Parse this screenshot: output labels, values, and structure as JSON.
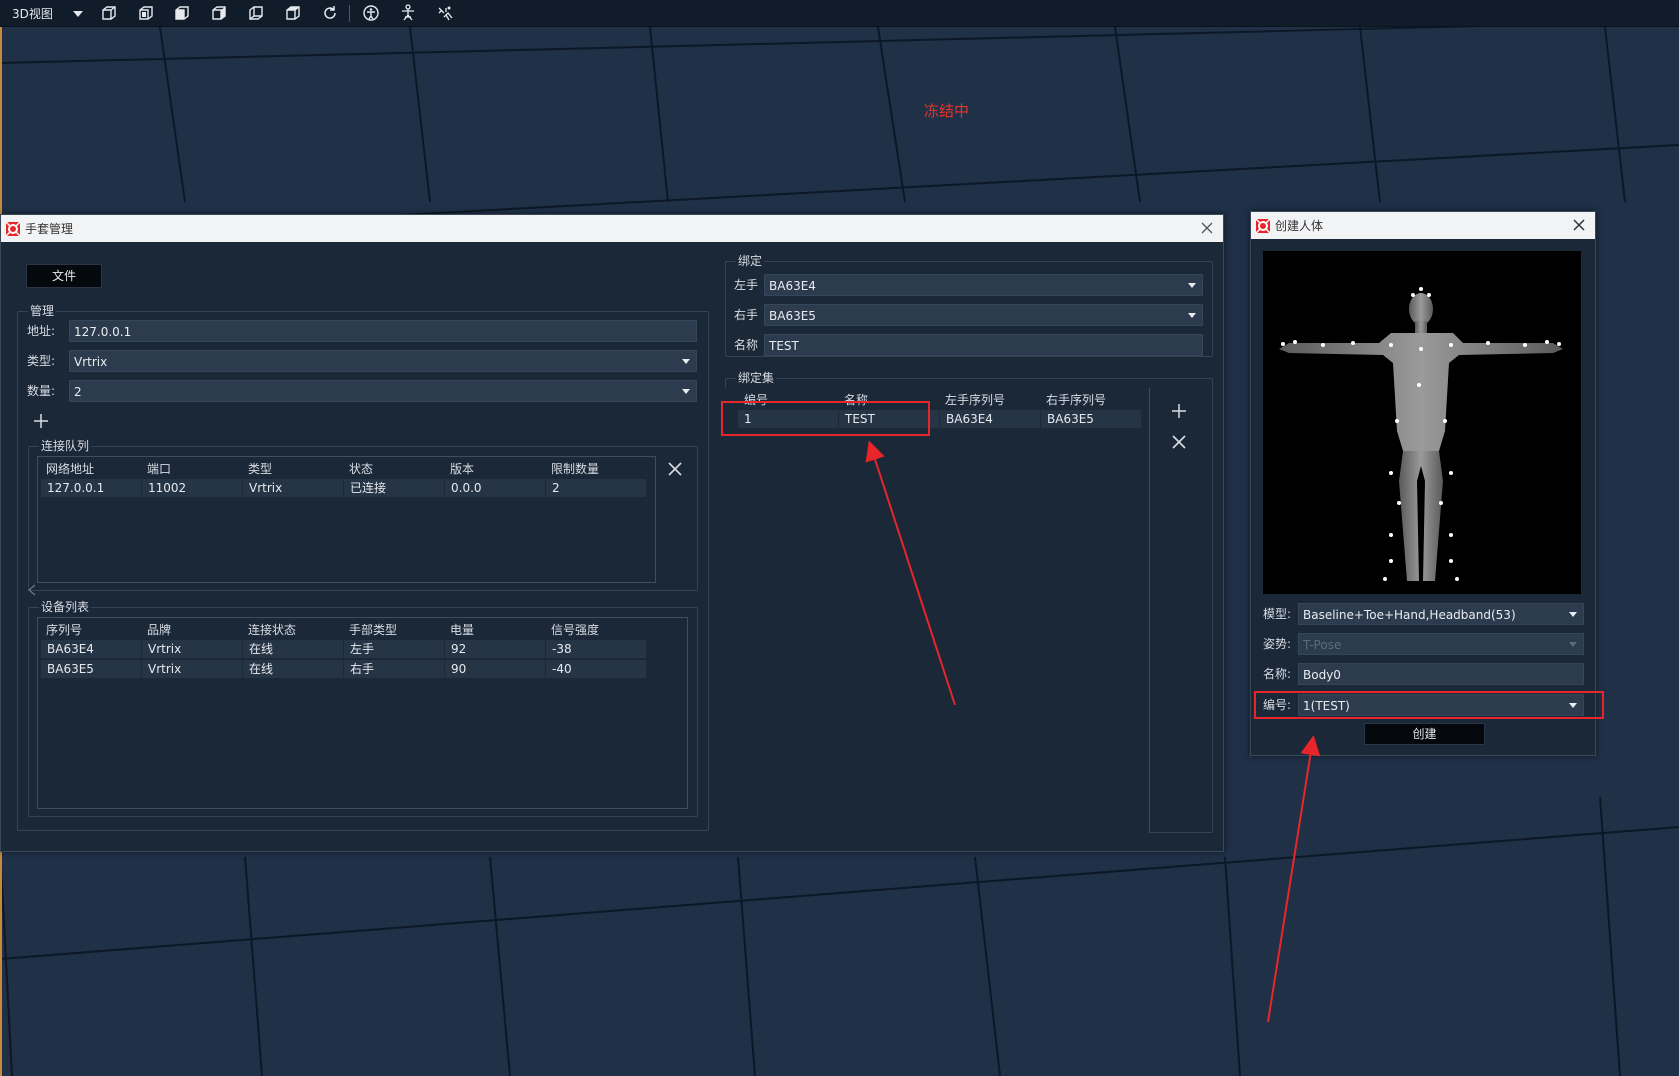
{
  "toolbar": {
    "view_label": "3D视图",
    "icons": [
      "front-view-icon",
      "perspective-view-icon",
      "left-view-icon",
      "right-view-icon",
      "back-view-icon",
      "top-view-icon",
      "refresh-icon",
      "person-icon",
      "skeleton-icon",
      "tracker-icon"
    ]
  },
  "viewport": {
    "status_text": "冻结中"
  },
  "glove_manager": {
    "title": "手套管理",
    "file_button": "文件",
    "manage": {
      "title": "管理",
      "address_label": "地址:",
      "address_value": "127.0.0.1",
      "type_label": "类型:",
      "type_value": "Vrtrix",
      "count_label": "数量:",
      "count_value": "2"
    },
    "connection_queue": {
      "title": "连接队列",
      "columns": [
        "网络地址",
        "端口",
        "类型",
        "状态",
        "版本",
        "限制数量"
      ],
      "rows": [
        [
          "127.0.0.1",
          "11002",
          "Vrtrix",
          "已连接",
          "0.0.0",
          "2"
        ]
      ]
    },
    "device_list": {
      "title": "设备列表",
      "columns": [
        "序列号",
        "品牌",
        "连接状态",
        "手部类型",
        "电量",
        "信号强度"
      ],
      "rows": [
        [
          "BA63E4",
          "Vrtrix",
          "在线",
          "左手",
          "92",
          "-38"
        ],
        [
          "BA63E5",
          "Vrtrix",
          "在线",
          "右手",
          "90",
          "-40"
        ]
      ]
    },
    "binding": {
      "title": "绑定",
      "left_label": "左手",
      "left_value": "BA63E4",
      "right_label": "右手",
      "right_value": "BA63E5",
      "name_label": "名称",
      "name_value": "TEST"
    },
    "binding_set": {
      "title": "绑定集",
      "columns": [
        "编号",
        "名称",
        "左手序列号",
        "右手序列号"
      ],
      "rows": [
        [
          "1",
          "TEST",
          "BA63E4",
          "BA63E5"
        ]
      ]
    }
  },
  "create_body": {
    "title": "创建人体",
    "model_label": "模型:",
    "model_value": "Baseline+Toe+Hand,Headband(53)",
    "pose_label": "姿势:",
    "pose_value": "T-Pose",
    "name_label": "名称:",
    "name_value": "Body0",
    "id_label": "编号:",
    "id_value": "1(TEST)",
    "create_button": "创建"
  },
  "colors": {
    "viewport_bg": "#1f3047",
    "toolbar_bg": "#101c2a",
    "dialog_bg": "#1a2838",
    "field_bg": "#2c3b4d",
    "annotation_red": "#e8252a",
    "status_red": "#e8332a"
  }
}
